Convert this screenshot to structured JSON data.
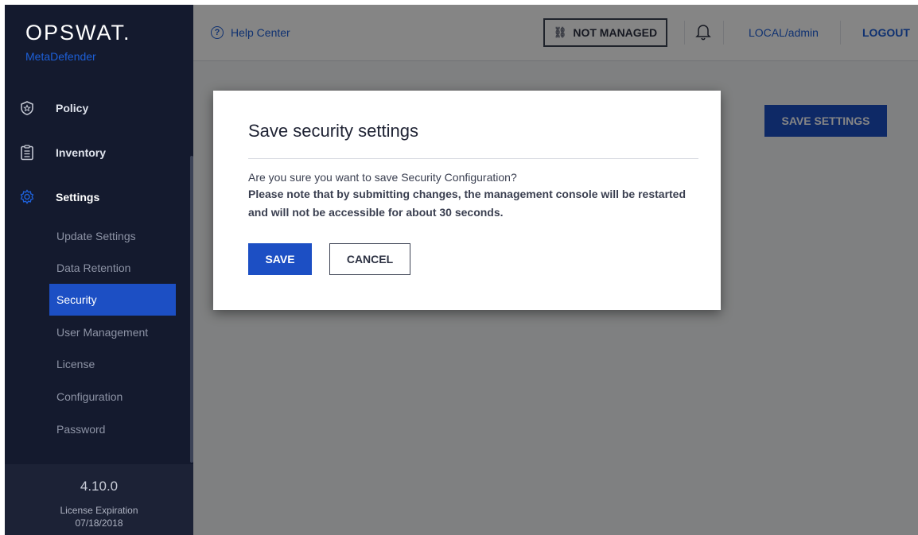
{
  "brand": {
    "name": "OPSWAT.",
    "product": "MetaDefender"
  },
  "sidebar": {
    "main_items": [
      {
        "label": "Policy",
        "icon": "shield-star-icon"
      },
      {
        "label": "Inventory",
        "icon": "clipboard-icon"
      },
      {
        "label": "Settings",
        "icon": "gear-icon"
      }
    ],
    "sub_items": [
      {
        "label": "Update Settings"
      },
      {
        "label": "Data Retention"
      },
      {
        "label": "Security"
      },
      {
        "label": "User Management"
      },
      {
        "label": "License"
      },
      {
        "label": "Configuration"
      },
      {
        "label": "Password"
      }
    ],
    "active_sub_item": "Security",
    "footer": {
      "version": "4.10.0",
      "license_label": "License Expiration",
      "license_date": "07/18/2018"
    }
  },
  "header": {
    "help_label": "Help Center",
    "managed_badge": "NOT MANAGED",
    "user": "LOCAL/admin",
    "logout": "LOGOUT"
  },
  "main": {
    "save_settings_label": "SAVE SETTINGS"
  },
  "dialog": {
    "title": "Save security settings",
    "line1": "Are you sure you want to save Security Configuration?",
    "line2": "Please note that by submitting changes, the management console will be restarted",
    "line3": "and will not be accessible for about 30 seconds.",
    "save_label": "SAVE",
    "cancel_label": "CANCEL"
  },
  "colors": {
    "sidebar_bg": "#141a2e",
    "accent": "#1c4fc4",
    "link": "#1d5fd8"
  }
}
